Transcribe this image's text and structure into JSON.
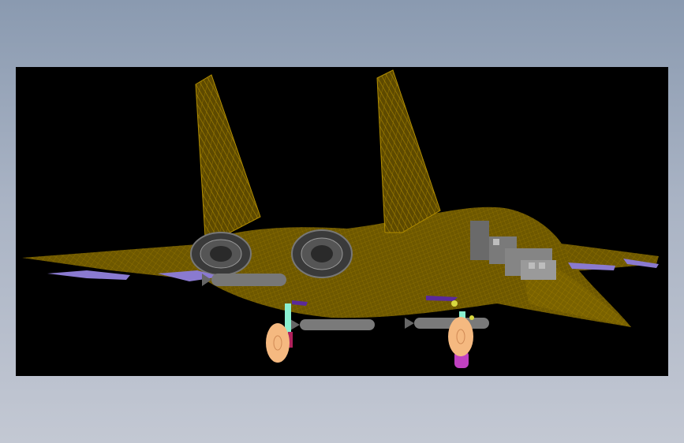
{
  "viewport": {
    "background_color": "#000000",
    "model": {
      "subject": "fighter-jet-wireframe",
      "wireframe_color": "#7a6200",
      "missile_color": "#777777",
      "pylon_color": "#8a7ad0",
      "tire_color": "#f5b980",
      "strut_color": "#8af0d0",
      "accent_magenta": "#c040c0",
      "accent_yellow": "#d8d840"
    }
  }
}
